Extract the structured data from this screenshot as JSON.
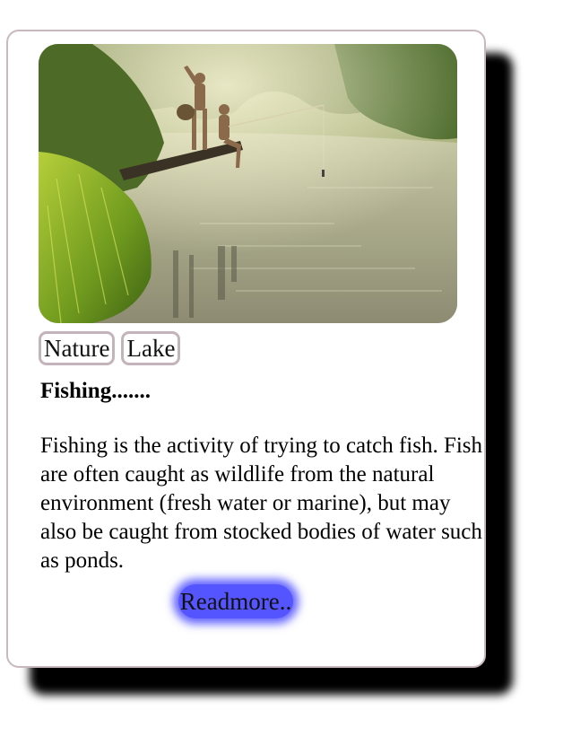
{
  "card": {
    "image_alt": "Two boys fishing from a log over a river",
    "tags": [
      "Nature",
      "Lake"
    ],
    "title": "Fishing.......",
    "description": "Fishing is the activity of trying to catch fish. Fish are often caught as wildlife from the natural environment (fresh water or marine), but may also be caught from stocked bodies of water such as ponds.",
    "readmore_label": "Readmore.."
  },
  "colors": {
    "card_border": "#c9b8bf",
    "card_shadow": "#000000",
    "button_bg": "#5555ff",
    "tag_border": "#c3b3ba"
  }
}
